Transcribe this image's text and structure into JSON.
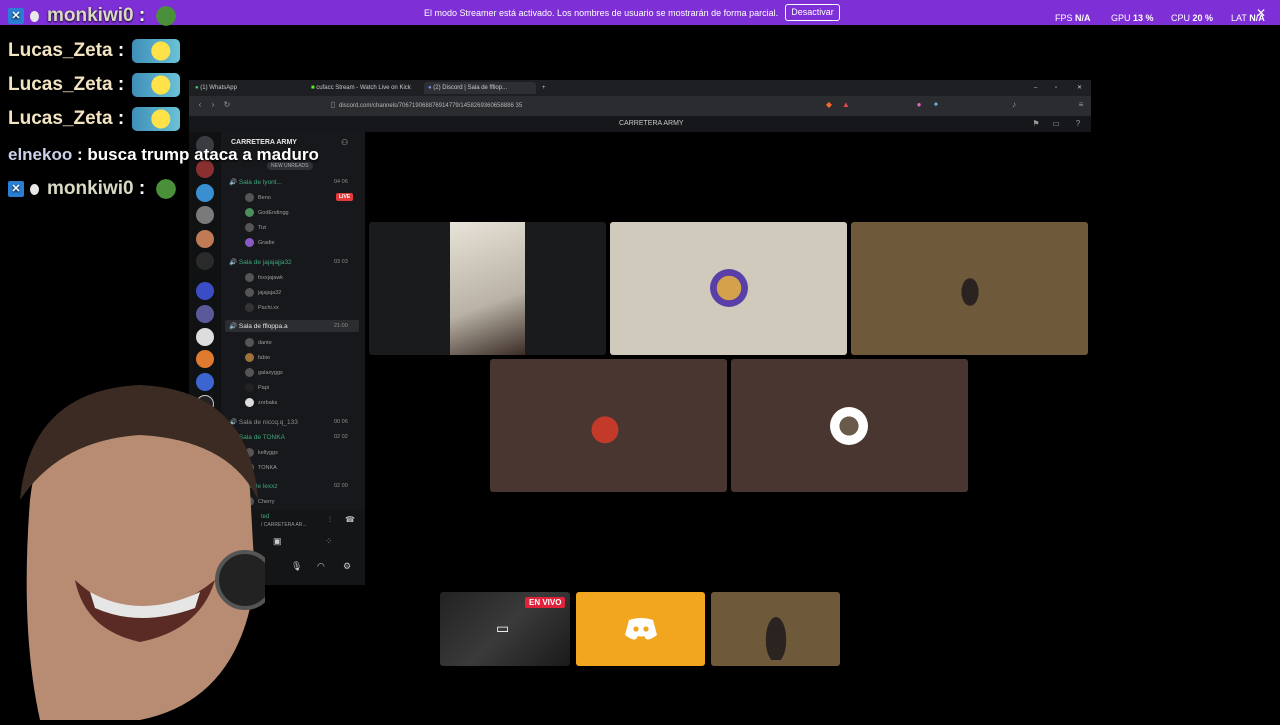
{
  "streamer_bar": {
    "message": "El modo Streamer está activado. Los nombres de usuario se mostrarán de forma parcial.",
    "deactivate_label": "Desactivar",
    "fps_label": "FPS",
    "fps_value": "N/A",
    "gpu_label": "GPU",
    "gpu_value": "13 %",
    "cpu_label": "CPU",
    "cpu_value": "20 %",
    "lat_label": "LAT",
    "lat_value": "N/A",
    "close_icon": "close-icon"
  },
  "chat": [
    {
      "name": "monkiwi0",
      "sep": ":",
      "text": ""
    },
    {
      "name": "Lucas_Zeta",
      "sep": ":",
      "text": ""
    },
    {
      "name": "Lucas_Zeta",
      "sep": ":",
      "text": ""
    },
    {
      "name": "Lucas_Zeta",
      "sep": ":",
      "text": ""
    },
    {
      "name": "elnekoo",
      "sep": ":",
      "text": "busca trump ataca a maduro"
    },
    {
      "name": "monkiwi0",
      "sep": ":",
      "text": ""
    }
  ],
  "browser": {
    "tabs": [
      "(1) WhatsApp",
      "cufacc Stream - Watch Live on Kick",
      "(2) Discord | Sala de ffllop..."
    ],
    "url": "discord.com/channels/706719068876914779/1458269360658886 35",
    "server_title": "CARRETERA ARMY"
  },
  "discord": {
    "server_name": "CARRETERA ARMY",
    "new_unreads": "NEW UNREADS",
    "channels": [
      {
        "name": "Sala de lyont...",
        "count": "04 06"
      },
      {
        "name": "Sala de jajajajja32",
        "count": "03 03"
      },
      {
        "name": "Sala de ffloppa.a",
        "count": "21:00"
      },
      {
        "name": "Sala de niccq.q_133",
        "count": "00 06"
      },
      {
        "name": "Sala de TONKA",
        "count": "02 02"
      },
      {
        "name": "Sala de lexxz",
        "count": "02 00"
      }
    ],
    "members_1": [
      "Beno",
      "GodEndingg",
      "Tizi",
      "Gradie"
    ],
    "members_2": [
      "fxxxjajawk",
      "jajajaja32",
      "Pachi.xx"
    ],
    "members_3": [
      "dante",
      "fabio",
      "galaxyggs",
      "Papi",
      "zorbaks"
    ],
    "members_5": [
      "kellyggs",
      "TONKA"
    ],
    "members_6": [
      "Cherry"
    ],
    "live_badge": "LIVE",
    "user_panel_name": "ted",
    "user_panel_sub": "/ CARRETERA AR..."
  },
  "bottom_strip": {
    "live_label": "EN VIVO"
  },
  "colors": {
    "streamer_bar": "#7e2fd6",
    "discord_orange": "#f2a51e",
    "tile_beige": "#cfcabb",
    "tile_brown": "#6e5a3a",
    "tile_darkbrown": "#4a3630"
  }
}
